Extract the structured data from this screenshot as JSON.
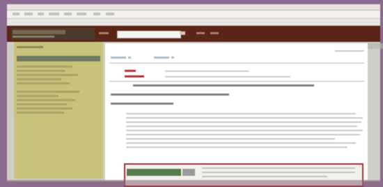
{
  "colors": {
    "desktop_purple": "#8a6a8e",
    "header_maroon": "#5a2416",
    "sidebar_olive": "#c8c37a",
    "content_white": "#ffffff",
    "link_red": "#b2333b",
    "box_border": "#9b3434"
  },
  "icons": [
    "back-icon",
    "forward-icon",
    "search-icon"
  ],
  "search": {
    "value": "",
    "placeholder": ""
  }
}
